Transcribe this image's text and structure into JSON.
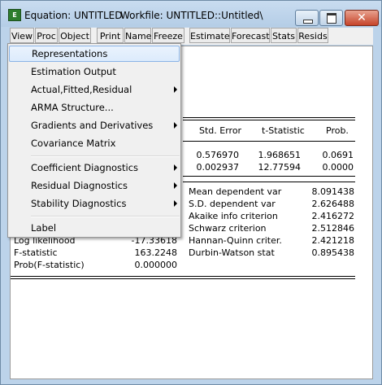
{
  "window": {
    "title": "Equation: UNTITLED",
    "workfile": "Workfile: UNTITLED::Untitled\\",
    "app_icon": "eviews-icon"
  },
  "toolbar": [
    "View",
    "Proc",
    "Object",
    "Print",
    "Name",
    "Freeze",
    "Estimate",
    "Forecast",
    "Stats",
    "Resids"
  ],
  "menu": {
    "items": [
      {
        "label": "Representations",
        "submenu": false,
        "highlighted": true
      },
      {
        "label": "Estimation Output",
        "submenu": false
      },
      {
        "label": "Actual,Fitted,Residual",
        "submenu": true
      },
      {
        "label": "ARMA Structure...",
        "submenu": false
      },
      {
        "label": "Gradients and Derivatives",
        "submenu": true
      },
      {
        "label": "Covariance Matrix",
        "submenu": false
      },
      {
        "label": "Coefficient Diagnostics",
        "submenu": true
      },
      {
        "label": "Residual Diagnostics",
        "submenu": true
      },
      {
        "label": "Stability Diagnostics",
        "submenu": true
      },
      {
        "label": "Label",
        "submenu": false
      }
    ]
  },
  "output": {
    "headers": {
      "std_error": "Std. Error",
      "t_stat": "t-Statistic",
      "prob": "Prob."
    },
    "coef_rows": [
      {
        "std_error": "0.576970",
        "t_stat": "1.968651",
        "prob": "0.0691"
      },
      {
        "std_error": "0.002937",
        "t_stat": "12.77594",
        "prob": "0.0000"
      }
    ],
    "stats_right": [
      {
        "label": "Mean dependent var",
        "value": "8.091438"
      },
      {
        "label": "S.D. dependent var",
        "value": "2.626488"
      },
      {
        "label": "Akaike info criterion",
        "value": "2.416272"
      },
      {
        "label": "Schwarz criterion",
        "value": "2.512846"
      },
      {
        "label": "Hannan-Quinn criter.",
        "value": "2.421218"
      },
      {
        "label": "Durbin-Watson stat",
        "value": "0.895438"
      }
    ],
    "stats_left": [
      {
        "label": "Log likelihood",
        "value": "-17.33618"
      },
      {
        "label": "F-statistic",
        "value": "163.2248"
      },
      {
        "label": "Prob(F-statistic)",
        "value": "0.000000"
      }
    ]
  }
}
